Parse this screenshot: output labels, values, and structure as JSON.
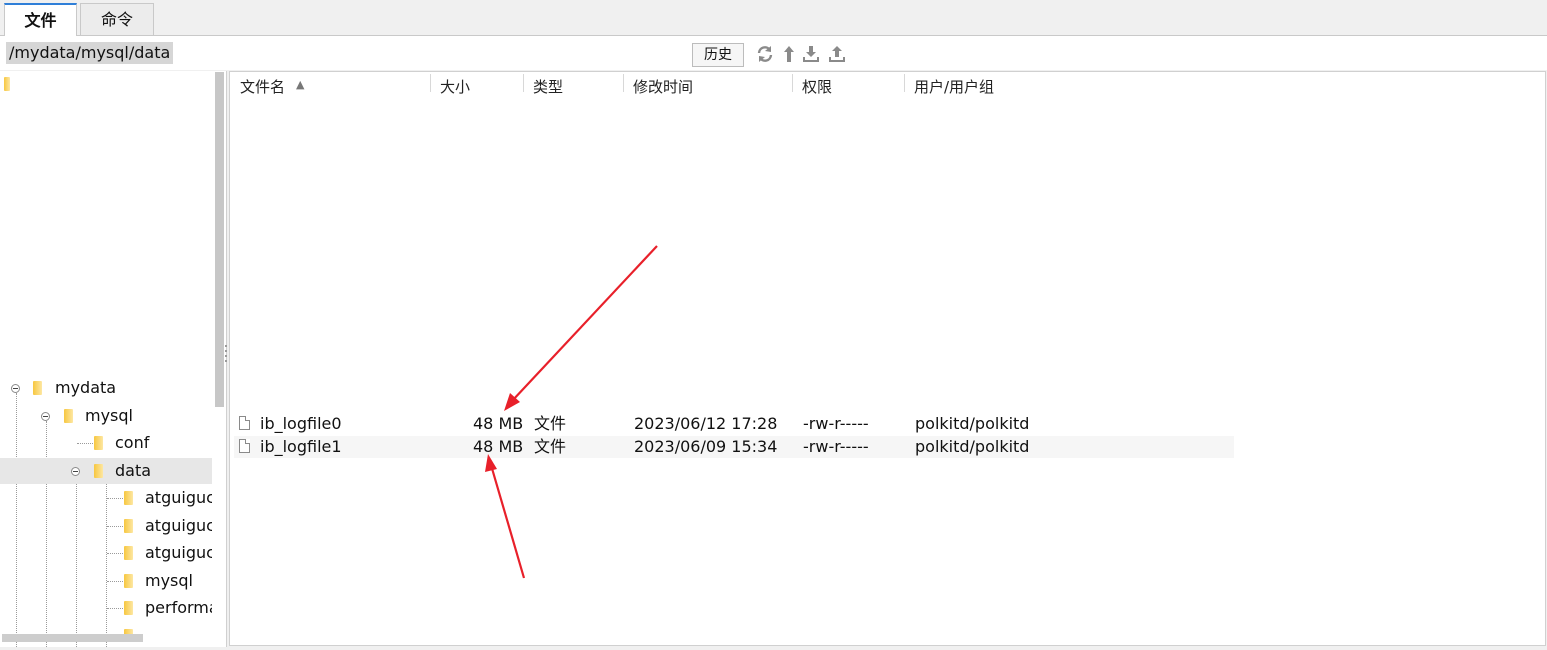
{
  "tabs": {
    "files": "文件",
    "commands": "命令"
  },
  "pathbar": {
    "path": "/mydata/mysql/data",
    "history_label": "历史"
  },
  "toolbar_icons": [
    "refresh-icon",
    "up-directory-icon",
    "download-icon",
    "upload-icon"
  ],
  "tree": {
    "items": [
      {
        "label": "mydata",
        "depth": 0,
        "expanded": true
      },
      {
        "label": "mysql",
        "depth": 1,
        "expanded": true
      },
      {
        "label": "conf",
        "depth": 2,
        "expanded": false
      },
      {
        "label": "data",
        "depth": 2,
        "expanded": true,
        "selected": true
      },
      {
        "label": "atguiguc",
        "depth": 3
      },
      {
        "label": "atguiguc",
        "depth": 3
      },
      {
        "label": "atguiguc",
        "depth": 3
      },
      {
        "label": "mysql",
        "depth": 3
      },
      {
        "label": "performa",
        "depth": 3
      }
    ]
  },
  "list": {
    "columns": [
      "文件名",
      "大小",
      "类型",
      "修改时间",
      "权限",
      "用户/用户组"
    ],
    "sort_indicator": "▲",
    "rows": [
      {
        "name": "ib_logfile0",
        "size": "48 MB",
        "type": "文件",
        "modified": "2023/06/12 17:28",
        "perms": "-rw-r-----",
        "owner": "polkitd/polkitd"
      },
      {
        "name": "ib_logfile1",
        "size": "48 MB",
        "type": "文件",
        "modified": "2023/06/09 15:34",
        "perms": "-rw-r-----",
        "owner": "polkitd/polkitd"
      }
    ]
  },
  "colors": {
    "accent": "#2f7fd8",
    "annotation_arrow": "#e8202a",
    "folder": "#f7c740"
  }
}
